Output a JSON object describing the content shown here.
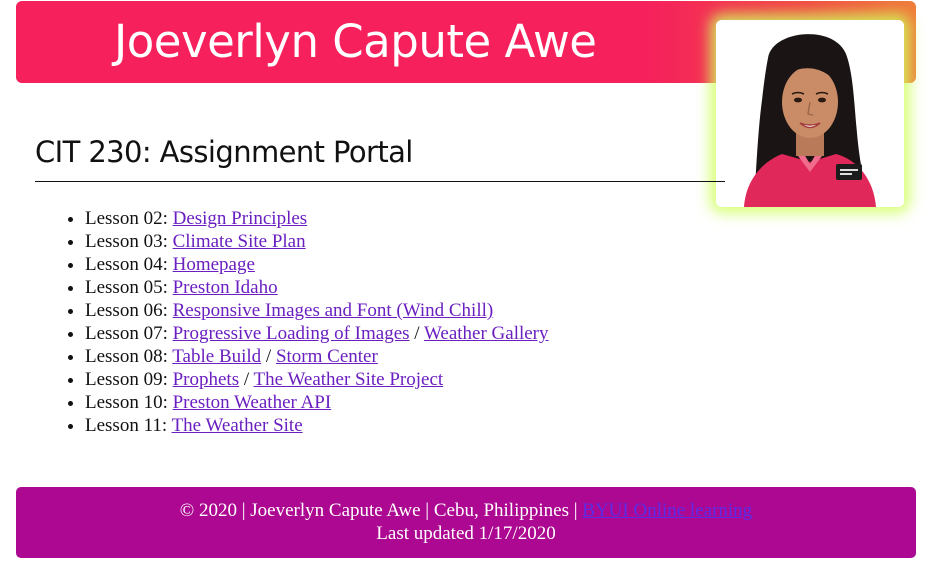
{
  "header": {
    "title": "Joeverlyn Capute Awe",
    "photo_icon": "portrait-photo"
  },
  "main": {
    "heading": "CIT 230: Assignment Portal",
    "lessons": [
      {
        "prefix": "Lesson 02: ",
        "links": [
          "Design Principles"
        ]
      },
      {
        "prefix": "Lesson 03: ",
        "links": [
          "Climate Site Plan"
        ]
      },
      {
        "prefix": "Lesson 04: ",
        "links": [
          "Homepage"
        ]
      },
      {
        "prefix": "Lesson 05: ",
        "links": [
          "Preston Idaho"
        ]
      },
      {
        "prefix": "Lesson 06: ",
        "links": [
          "Responsive Images and Font (Wind Chill)"
        ]
      },
      {
        "prefix": "Lesson 07: ",
        "links": [
          "Progressive Loading of Images",
          "Weather Gallery"
        ],
        "separator": " / "
      },
      {
        "prefix": "Lesson 08: ",
        "links": [
          "Table Build",
          "Storm Center"
        ],
        "separator": " / "
      },
      {
        "prefix": "Lesson 09: ",
        "links": [
          "Prophets",
          "The Weather Site Project"
        ],
        "separator": " / "
      },
      {
        "prefix": "Lesson 10: ",
        "links": [
          "Preston Weather API"
        ]
      },
      {
        "prefix": "Lesson 11: ",
        "links": [
          "The Weather Site"
        ]
      }
    ]
  },
  "footer": {
    "line1_text": "© 2020 | Joeverlyn Capute Awe | Cebu, Philippines | ",
    "line1_link": "BYUI Online learning",
    "line2": "Last updated 1/17/2020"
  },
  "colors": {
    "header_bg": "#f5205c",
    "footer_bg": "#ad0891",
    "link": "#6a1fc0",
    "footer_link": "#5b2de8",
    "photo_glow": "#d0ff5c"
  }
}
